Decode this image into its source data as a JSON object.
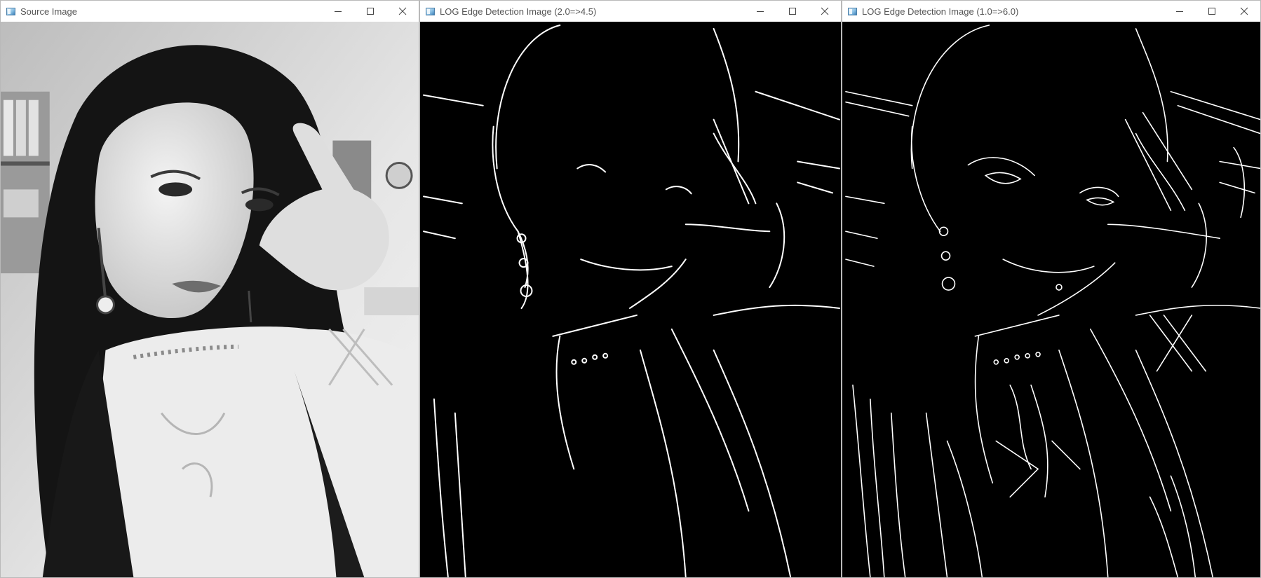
{
  "windows": [
    {
      "title": "Source Image",
      "icon": "opencv-window-icon",
      "controls": [
        "minimize",
        "maximize",
        "close"
      ],
      "content": "grayscale photo"
    },
    {
      "title": "LOG Edge Detection Image (2.0=>4.5)",
      "icon": "opencv-window-icon",
      "controls": [
        "minimize",
        "maximize",
        "close"
      ],
      "content": "edge map"
    },
    {
      "title": "LOG Edge Detection Image (1.0=>6.0)",
      "icon": "opencv-window-icon",
      "controls": [
        "minimize",
        "maximize",
        "close"
      ],
      "content": "edge map"
    }
  ],
  "colors": {
    "titlebar_bg": "#ffffff",
    "title_text": "#555555",
    "edge_bg": "#000000",
    "edge_line": "#ffffff"
  }
}
